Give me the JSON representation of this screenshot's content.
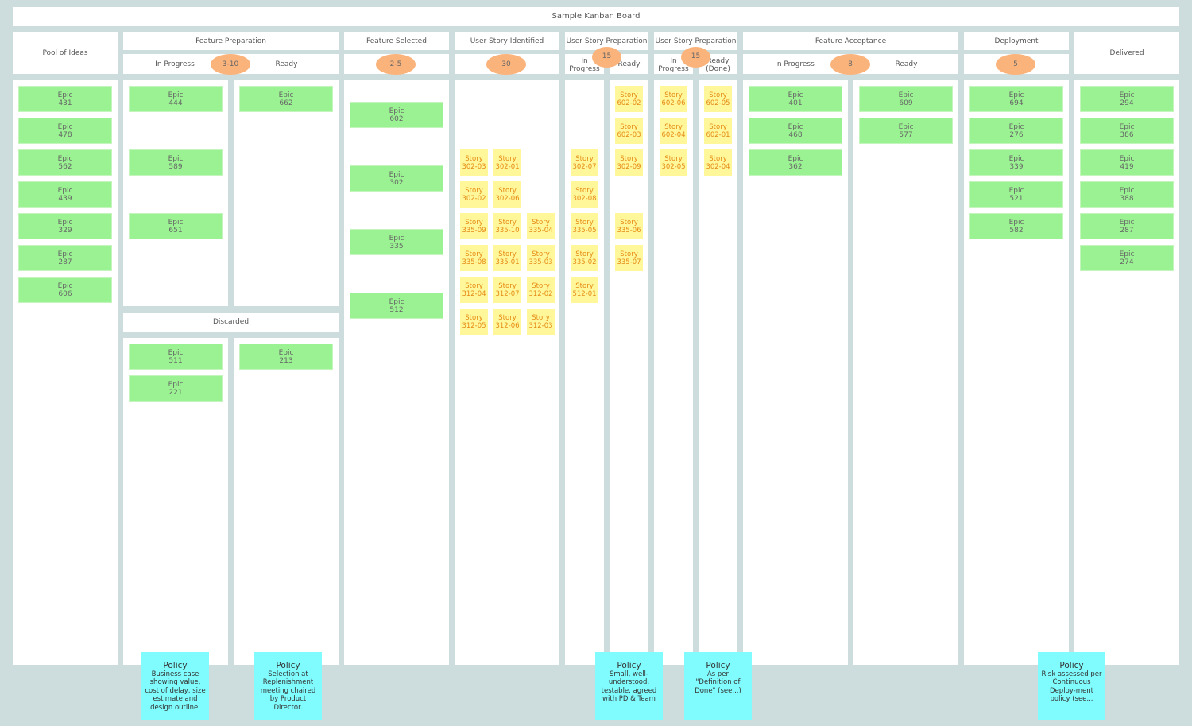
{
  "board": {
    "title": "Sample Kanban Board"
  },
  "columns": {
    "pool": {
      "title": "Pool of Ideas",
      "cards": [
        "431",
        "478",
        "562",
        "439",
        "329",
        "287",
        "606"
      ]
    },
    "feature_preparation": {
      "title": "Feature Preparation",
      "wip_limit": "3-10",
      "in_progress": {
        "label": "In Progress",
        "cards": [
          "444",
          "589",
          "651"
        ]
      },
      "ready": {
        "label": "Ready",
        "cards": [
          "662"
        ]
      },
      "discarded": {
        "label": "Discarded",
        "left_cards": [
          "511",
          "221"
        ],
        "right_cards": [
          "213"
        ]
      },
      "policies": [
        {
          "heading": "Policy",
          "text": "Business case showing value, cost of delay, size estimate and design outline."
        },
        {
          "heading": "Policy",
          "text": "Selection at Replenishment meeting chaired by Product Director."
        }
      ]
    },
    "feature_selected": {
      "title": "Feature Selected",
      "wip_limit": "2-5",
      "cards": [
        "602",
        "302",
        "335",
        "512"
      ]
    },
    "user_story_identified": {
      "title": "User Story Identified",
      "wip_limit": "30",
      "rows": [
        [
          "302-03",
          "302-01"
        ],
        [
          "302-02",
          "302-06"
        ],
        [
          "335-09",
          "335-10",
          "335-04"
        ],
        [
          "335-08",
          "335-01",
          "335-03"
        ],
        [
          "312-04",
          "312-07",
          "312-02"
        ],
        [
          "312-05",
          "312-06",
          "312-03"
        ]
      ]
    },
    "user_story_preparation_1": {
      "title": "User Story Preparation",
      "wip_limit": "15",
      "in_progress": {
        "label": "In Progress",
        "cards": [
          "302-07",
          "302-08",
          "335-05",
          "335-02",
          "512-01"
        ]
      },
      "ready": {
        "label": "Ready",
        "cards": [
          "602-02",
          "602-03",
          "302-09",
          null,
          "335-06",
          "335-07"
        ]
      },
      "policy": {
        "heading": "Policy",
        "text": "Small, well-understood, testable, agreed with PD & Team"
      }
    },
    "user_story_preparation_2": {
      "title": "User Story Preparation",
      "wip_limit": "15",
      "in_progress": {
        "label": "In Progress",
        "cards": [
          "602-06",
          "602-04",
          "302-05"
        ]
      },
      "ready": {
        "label": "Ready (Done)",
        "cards": [
          "602-05",
          "602-01",
          "302-04"
        ]
      },
      "policy": {
        "heading": "Policy",
        "text": "As per \"Definition of Done\" (see...)"
      }
    },
    "feature_acceptance": {
      "title": "Feature Acceptance",
      "wip_limit": "8",
      "in_progress": {
        "label": "In Progress",
        "cards": [
          "401",
          "468",
          "362"
        ]
      },
      "ready": {
        "label": "Ready",
        "cards": [
          "609",
          "577"
        ]
      }
    },
    "deployment": {
      "title": "Deployment",
      "wip_limit": "5",
      "cards": [
        "694",
        "276",
        "339",
        "521",
        "582"
      ],
      "policy": {
        "heading": "Policy",
        "text": "Risk assessed per Continuous Deploy-ment policy (see..."
      }
    },
    "delivered": {
      "title": "Delivered",
      "cards": [
        "294",
        "386",
        "419",
        "388",
        "287",
        "274"
      ]
    }
  },
  "card_labels": {
    "epic": "Epic",
    "story": "Story"
  },
  "colors": {
    "background": "#cddcdc",
    "epic": "#9bf293",
    "story": "#fff799",
    "story_text": "#e58a14",
    "wip": "#fbb37c",
    "policy": "#80fcfe"
  }
}
